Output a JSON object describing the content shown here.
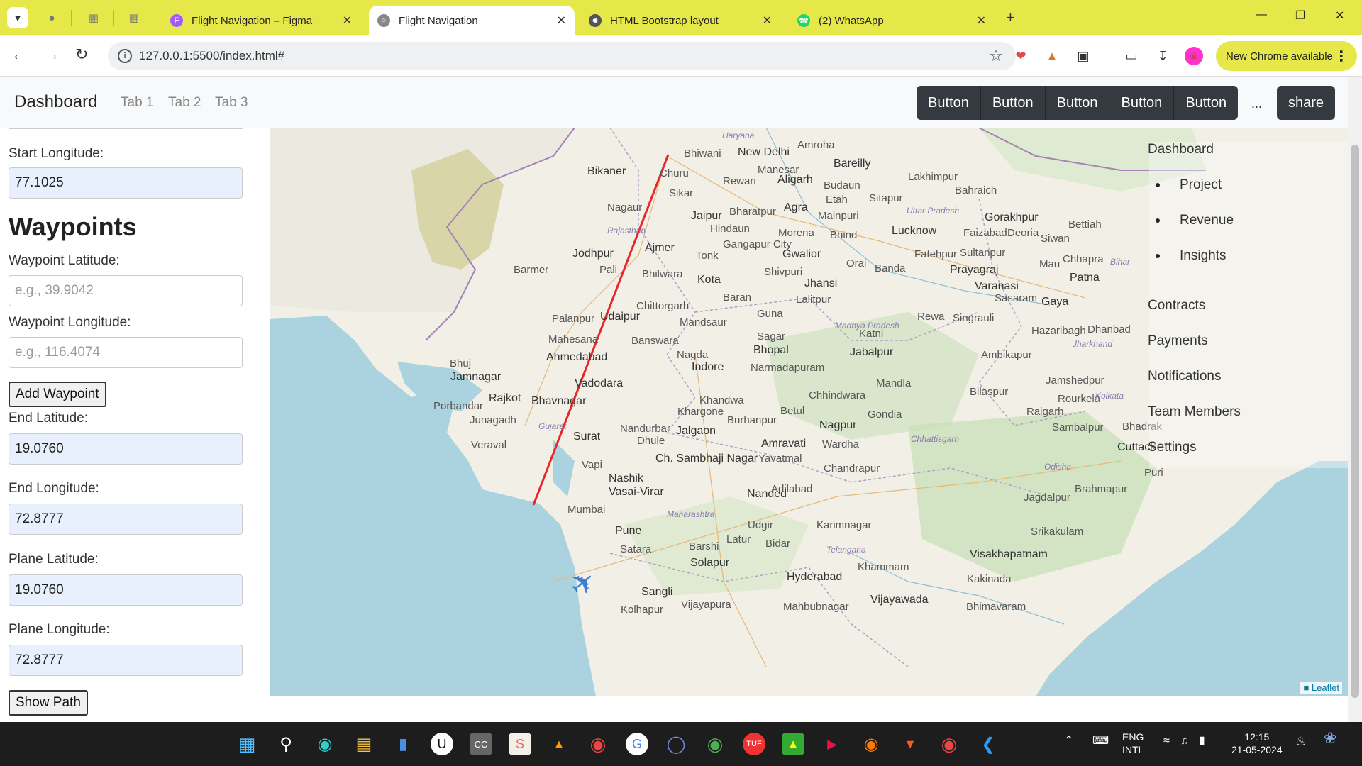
{
  "browser": {
    "tabs": [
      {
        "title": "Flight Navigation – Figma",
        "active": false
      },
      {
        "title": "Flight Navigation",
        "active": true
      },
      {
        "title": "HTML Bootstrap layout",
        "active": false
      },
      {
        "title": "(2) WhatsApp",
        "active": false
      }
    ],
    "url": "127.0.0.1:5500/index.html#",
    "update_label": "New Chrome available"
  },
  "navbar": {
    "brand": "Dashboard",
    "links": [
      "Tab 1",
      "Tab 2",
      "Tab 3"
    ],
    "buttons": [
      "Button",
      "Button",
      "Button",
      "Button",
      "Button"
    ],
    "ellipsis": "...",
    "share": "share"
  },
  "form": {
    "start_longitude_label": "Start Longitude:",
    "start_longitude_value": "77.1025",
    "waypoints_heading": "Waypoints",
    "waypoint_latitude_label": "Waypoint Latitude:",
    "waypoint_latitude_placeholder": "e.g., 39.9042",
    "waypoint_longitude_label": "Waypoint Longitude:",
    "waypoint_longitude_placeholder": "e.g., 116.4074",
    "add_waypoint": "Add Waypoint",
    "end_latitude_label": "End Latitude:",
    "end_latitude_value": "19.0760",
    "end_longitude_label": "End Longitude:",
    "end_longitude_value": "72.8777",
    "plane_latitude_label": "Plane Latitude:",
    "plane_latitude_value": "19.0760",
    "plane_longitude_label": "Plane Longitude:",
    "plane_longitude_value": "72.8777",
    "show_path": "Show Path"
  },
  "side_menu": {
    "items": [
      {
        "label": "Dashboard",
        "bullet": false
      },
      {
        "label": "Project",
        "bullet": true
      },
      {
        "label": "Revenue",
        "bullet": true
      },
      {
        "label": "Insights",
        "bullet": true
      },
      {
        "label": "Contracts",
        "bullet": false
      },
      {
        "label": "Payments",
        "bullet": false
      },
      {
        "label": "Notifications",
        "bullet": false
      },
      {
        "label": "Team Members",
        "bullet": false
      },
      {
        "label": "Settings",
        "bullet": false
      }
    ]
  },
  "map": {
    "attribution": "Leaflet",
    "route_color": "#e8262a",
    "cities": [
      "New Delhi",
      "Bhiwani",
      "Amroha",
      "Bareilly",
      "Rewari",
      "Aligarh",
      "Bikaner",
      "Churu",
      "Manesar",
      "Sikar",
      "Budaun",
      "Etah",
      "Nagaur",
      "Jaipur",
      "Agra",
      "Bharatpur",
      "Mainpuri",
      "Lakhimpur",
      "Bahraich",
      "Sitapur",
      "Lucknow",
      "Faizabad",
      "Gorakhpur",
      "Deoria",
      "Siwan",
      "Bettiah",
      "Hindaun",
      "Morena",
      "Bhind",
      "Gangapur City",
      "Gwalior",
      "Jodhpur",
      "Ajmer",
      "Tonk",
      "Pali",
      "Barmer",
      "Bhilwara",
      "Kota",
      "Shivpuri",
      "Jhansi",
      "Orai",
      "Banda",
      "Fatehpur",
      "Sultanpur",
      "Prayagraj",
      "Varanasi",
      "Mau",
      "Chhapra",
      "Patna",
      "Lalitpur",
      "Baran",
      "Guna",
      "Chittorgarh",
      "Palanpur",
      "Udaipur",
      "Mandsaur",
      "Sasaram",
      "Gaya",
      "Rewa",
      "Singrauli",
      "Hazaribagh",
      "Dhanbad",
      "Mahesana",
      "Banswara",
      "Sagar",
      "Katni",
      "Ahmedabad",
      "Nagda",
      "Bhopal",
      "Jabalpur",
      "Ambikapur",
      "Bhuj",
      "Indore",
      "Narmadapuram",
      "Jamnagar",
      "Vadodara",
      "Mandla",
      "Bilaspur",
      "Jamshedpur",
      "Rajkot",
      "Bhavnagar",
      "Khandwa",
      "Chhindwara",
      "Rourkela",
      "Porbandar",
      "Junagadh",
      "Khargone",
      "Burhanpur",
      "Betul",
      "Gondia",
      "Raigarh",
      "Nandurbar",
      "Jalgaon",
      "Nagpur",
      "Sambalpur",
      "Surat",
      "Dhule",
      "Amravati",
      "Wardha",
      "Veraval",
      "Yavatmal",
      "Bhadrak",
      "Cuttack",
      "Vapi",
      "Ch. Sambhaji Nagar",
      "Chandrapur",
      "Nashik",
      "Puri",
      "Vasai-Virar",
      "Adilabad",
      "Brahmapur",
      "Nanded",
      "Jagdalpur",
      "Mumbai",
      "Pune",
      "Udgir",
      "Karimnagar",
      "Srikakulam",
      "Latur",
      "Bidar",
      "Satara",
      "Barshi",
      "Visakhapatnam",
      "Solapur",
      "Khammam",
      "Sangli",
      "Hyderabad",
      "Kakinada",
      "Vijayawada",
      "Vijayapura",
      "Mahbubnagar",
      "Bhimavaram",
      "Kolhapur"
    ],
    "regions": [
      "Haryana",
      "Rajasthan",
      "Uttar Pradesh",
      "Madhya Pradesh",
      "Jharkhand",
      "Gujarat",
      "Chhattisgarh",
      "Maharashtra",
      "Odisha",
      "Telangana",
      "Bihar",
      "Kolkata"
    ]
  },
  "taskbar": {
    "lang_line1": "ENG",
    "lang_line2": "INTL",
    "time": "12:15",
    "date": "21-05-2024"
  }
}
